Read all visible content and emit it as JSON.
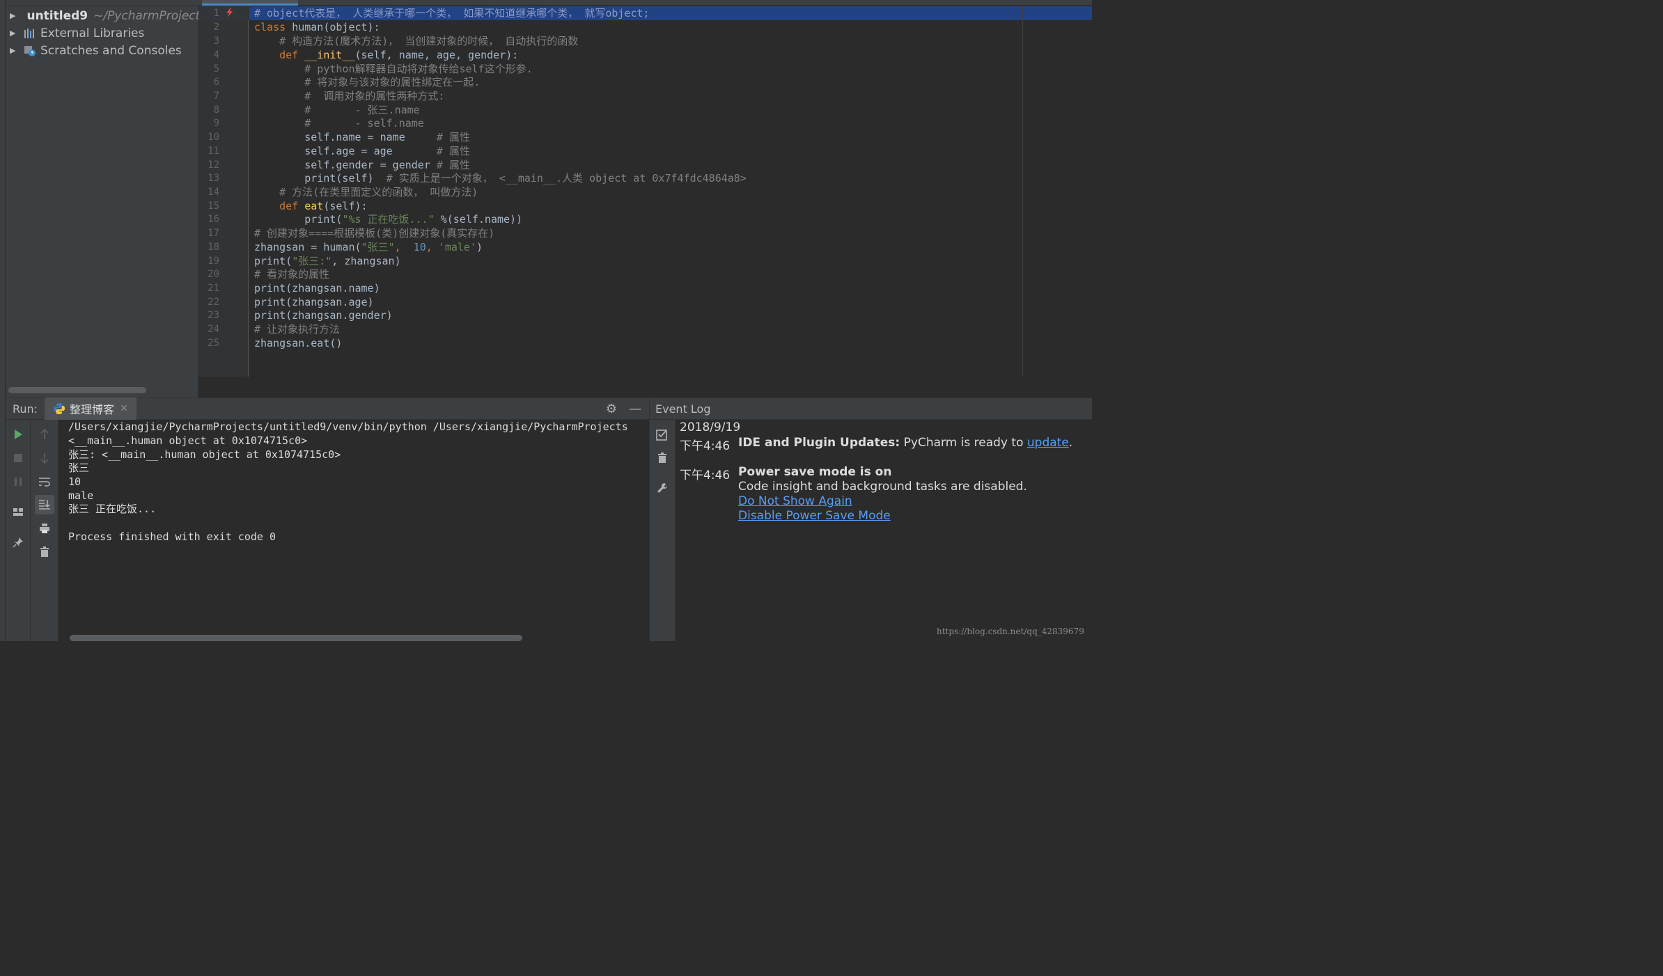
{
  "project_tree": {
    "items": [
      {
        "label": "untitled9",
        "path": "~/PycharmProject"
      },
      {
        "label": "External Libraries"
      },
      {
        "label": "Scratches and Consoles"
      }
    ]
  },
  "editor": {
    "line_numbers": [
      "1",
      "2",
      "3",
      "4",
      "5",
      "6",
      "7",
      "8",
      "9",
      "10",
      "11",
      "12",
      "13",
      "14",
      "15",
      "16",
      "17",
      "18",
      "19",
      "20",
      "21",
      "22",
      "23",
      "24",
      "25"
    ],
    "code": {
      "l1": "# object代表是， 人类继承于哪一个类， 如果不知道继承哪个类， 就写object;",
      "l2_kw": "class ",
      "l2_rest": "human(object):",
      "l3": "    # 构造方法(魔术方法)， 当创建对象的时候， 自动执行的函数",
      "l4_kw": "    def ",
      "l4_fn": "__init__",
      "l4_rest": "(self, name, age, gender):",
      "l5": "        # python解释器自动将对象传给self这个形参.",
      "l6": "        # 将对象与该对象的属性绑定在一起.",
      "l7": "        #  调用对象的属性两种方式:",
      "l8": "        #       - 张三.name",
      "l9": "        #       - self.name",
      "l10_code": "        self.name = name     ",
      "l10_cm": "# 属性",
      "l11_code": "        self.age = age       ",
      "l11_cm": "# 属性",
      "l12_code": "        self.gender = gender ",
      "l12_cm": "# 属性",
      "l13_code": "        print(self)  ",
      "l13_cm": "# 实质上是一个对象， <__main__.人类 object at 0x7f4fdc4864a8>",
      "l14": "    # 方法(在类里面定义的函数， 叫做方法)",
      "l15_kw": "    def ",
      "l15_fn": "eat",
      "l15_rest": "(self):",
      "l16_a": "        print(",
      "l16_str": "\"%s 正在吃饭...\"",
      "l16_b": " %(self.name))",
      "l17": "# 创建对象====根据模板(类)创建对象(真实存在)",
      "l18_a": "zhangsan = human(",
      "l18_s1": "\"张三\"",
      "l18_b": ",  ",
      "l18_n": "10",
      "l18_c": ", ",
      "l18_s2": "'male'",
      "l18_d": ")",
      "l19_a": "print(",
      "l19_s": "\"张三:\"",
      "l19_b": ", zhangsan)",
      "l20": "# 看对象的属性",
      "l21": "print(zhangsan.name)",
      "l22": "print(zhangsan.age)",
      "l23": "print(zhangsan.gender)",
      "l24": "# 让对象执行方法",
      "l25": "zhangsan.eat()"
    }
  },
  "run": {
    "title": "Run:",
    "tab_label": "整理博客",
    "console_lines": [
      "/Users/xiangjie/PycharmProjects/untitled9/venv/bin/python /Users/xiangjie/PycharmProjects",
      "<__main__.human object at 0x1074715c0>",
      "张三: <__main__.human object at 0x1074715c0>",
      "张三",
      "10",
      "male",
      "张三 正在吃饭...",
      "",
      "Process finished with exit code 0"
    ]
  },
  "event_log": {
    "title": "Event Log",
    "date": "2018/9/19",
    "entries": [
      {
        "time": "下午4:46",
        "title": "IDE and Plugin Updates:",
        "text": " PyCharm is ready to ",
        "link": "update",
        "tail": "."
      },
      {
        "time": "下午4:46",
        "title": "Power save mode is on",
        "text": "Code insight and background tasks are disabled.",
        "links": [
          "Do Not Show Again",
          "Disable Power Save Mode"
        ]
      }
    ]
  },
  "watermark": "https://blog.csdn.net/qq_42839679"
}
